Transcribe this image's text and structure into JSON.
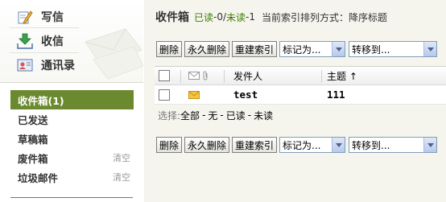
{
  "sidebar": {
    "quick": {
      "compose": "写信",
      "inbox": "收信",
      "contacts": "通讯录"
    },
    "folders": [
      {
        "label": "收件箱(1)"
      },
      {
        "label": "已发送"
      },
      {
        "label": "草稿箱"
      },
      {
        "label": "废件箱",
        "clear": "清空"
      },
      {
        "label": "垃圾邮件",
        "clear": "清空"
      }
    ]
  },
  "header": {
    "title": "收件箱",
    "read_label": "已读",
    "read_sep": "-0/",
    "unread_label": "未读",
    "unread_count": "-1",
    "sort_info": "当前索引排列方式：降序标题"
  },
  "toolbar": {
    "delete": "删除",
    "perm_delete": "永久删除",
    "rebuild_index": "重建索引",
    "mark_as": "标记为...",
    "move_to": "转移到..."
  },
  "table": {
    "headers": {
      "sender": "发件人",
      "subject": "主题",
      "sort_arrow": "↑"
    },
    "rows": [
      {
        "sender": "test",
        "subject": "111"
      }
    ]
  },
  "select_bar": {
    "label": "选择:",
    "all": "全部",
    "none": "无",
    "read": "已读",
    "unread": "未读",
    "sep": "-"
  },
  "colors": {
    "accent": "#6b8a30",
    "main_bg": "#f5f5ee",
    "status_green": "#3d7a00"
  }
}
